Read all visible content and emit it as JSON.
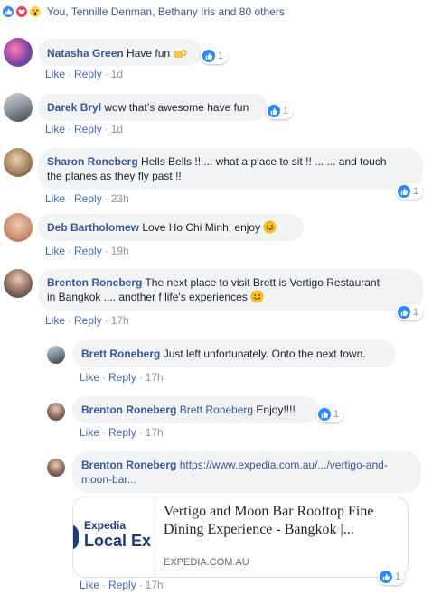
{
  "reactions": {
    "text": "You, Tennille Denman, Bethany Iris and 80 others",
    "icons": [
      "like-icon",
      "love-icon",
      "wow-icon"
    ]
  },
  "comments": [
    {
      "author": "Natasha Green",
      "text": "Have fun",
      "emoji": "beer-mug-icon",
      "likes": "1",
      "like_label": "Like",
      "reply_label": "Reply",
      "time": "1d"
    },
    {
      "author": "Darek Bryl",
      "text": "wow that’s awesome have fun",
      "likes": "1",
      "like_label": "Like",
      "reply_label": "Reply",
      "time": "1d"
    },
    {
      "author": "Sharon Roneberg",
      "text_line1": "Hells Bells !! ... what a place to sit !! ... ... and touch",
      "text_line2": "the planes as they fly past !!",
      "likes": "1",
      "like_label": "Like",
      "reply_label": "Reply",
      "time": "23h"
    },
    {
      "author": "Deb Bartholomew",
      "text": "Love Ho Chi Minh, enjoy",
      "emoji": "smiley-icon",
      "like_label": "Like",
      "reply_label": "Reply",
      "time": "19h"
    },
    {
      "author": "Brenton Roneberg",
      "text_line1": "The next place to visit Brett is Vertigo Restaurant",
      "text_line2": "in Bangkok .... another f life's experiences",
      "emoji": "smiley-icon",
      "likes": "1",
      "like_label": "Like",
      "reply_label": "Reply",
      "time": "17h"
    }
  ],
  "replies": [
    {
      "author": "Brett Roneberg",
      "text": "Just left unfortunately. Onto the next town.",
      "like_label": "Like",
      "reply_label": "Reply",
      "time": "17h"
    },
    {
      "author": "Brenton Roneberg",
      "mention": "Brett Roneberg",
      "text": "Enjoy!!!!",
      "likes": "1",
      "like_label": "Like",
      "reply_label": "Reply",
      "time": "17h"
    },
    {
      "author": "Brenton Roneberg",
      "link_line1": "https://www.expedia.com.au/.../vertigo-and-",
      "link_line2": "moon-bar...",
      "likes": "1",
      "like_label": "Like",
      "reply_label": "Reply",
      "time": "17h",
      "preview": {
        "logo_top": "Expedia",
        "logo_bottom": "Local Ex",
        "title_line1": "Vertigo and Moon Bar Rooftop Fine",
        "title_line2": "Dining Experience - Bangkok |...",
        "domain": "EXPEDIA.COM.AU"
      }
    }
  ],
  "colors": {
    "link": "#385898",
    "action": "#4267b2",
    "meta": "#90949c",
    "bubble": "#f2f3f5",
    "like_blue": "#2d88ff"
  }
}
